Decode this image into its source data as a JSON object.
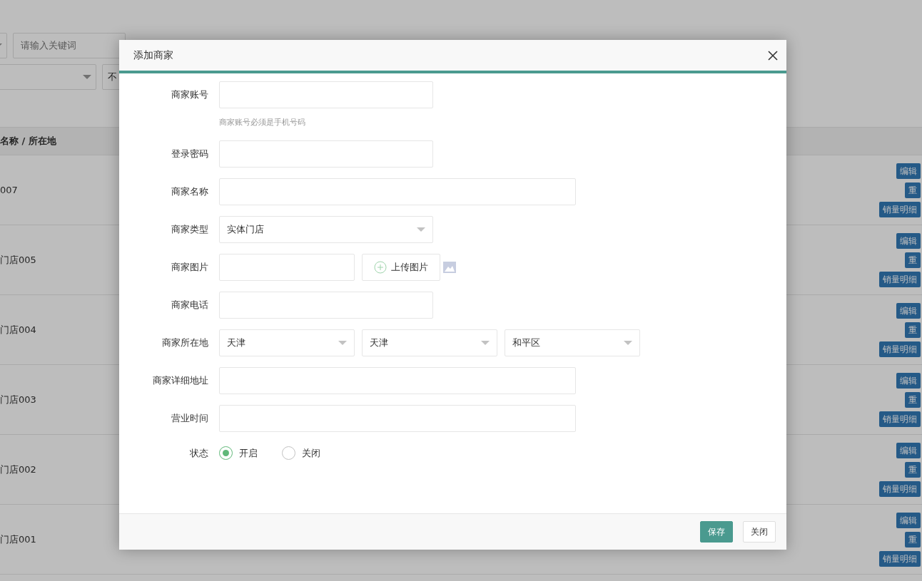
{
  "background": {
    "keyword": {
      "placeholder": "请输入关键词"
    },
    "filter_value": "不",
    "table": {
      "columns": [
        "名称 / 所在地"
      ],
      "rows": [
        {
          "name": "007",
          "actions": [
            "编辑",
            "重",
            "销量明细"
          ]
        },
        {
          "name": "门店005",
          "actions": [
            "编辑",
            "重",
            "销量明细"
          ]
        },
        {
          "name": "门店004",
          "actions": [
            "编辑",
            "重",
            "销量明细"
          ]
        },
        {
          "name": "门店003",
          "actions": [
            "编辑",
            "重",
            "销量明细"
          ]
        },
        {
          "name": "门店002",
          "actions": [
            "编辑",
            "重",
            "销量明细"
          ]
        },
        {
          "name": "门店001",
          "actions": [
            "编辑",
            "重",
            "销量明细"
          ]
        }
      ]
    }
  },
  "dialog": {
    "title": "添加商家",
    "fields": [
      {
        "kind": "short_text",
        "label": "商家账号",
        "help": "商家账号必须是手机号码"
      },
      {
        "kind": "short_text",
        "label": "登录密码"
      },
      {
        "kind": "long_text",
        "label": "商家名称"
      },
      {
        "kind": "select",
        "label": "商家类型",
        "value": "实体门店"
      },
      {
        "kind": "upload",
        "label": "商家图片",
        "button": "上传图片"
      },
      {
        "kind": "short_text",
        "label": "商家电话"
      },
      {
        "kind": "region",
        "label": "商家所在地",
        "values": [
          "天津",
          "天津",
          "和平区"
        ]
      },
      {
        "kind": "long_text",
        "label": "商家详细地址"
      },
      {
        "kind": "long_text",
        "label": "营业时间"
      },
      {
        "kind": "radio",
        "label": "状态",
        "options": [
          {
            "label": "开启",
            "selected": true
          },
          {
            "label": "关闭",
            "selected": false
          }
        ]
      }
    ],
    "buttons": [
      {
        "label": "保存",
        "kind": "primary"
      },
      {
        "label": "关闭",
        "kind": "default"
      }
    ]
  }
}
